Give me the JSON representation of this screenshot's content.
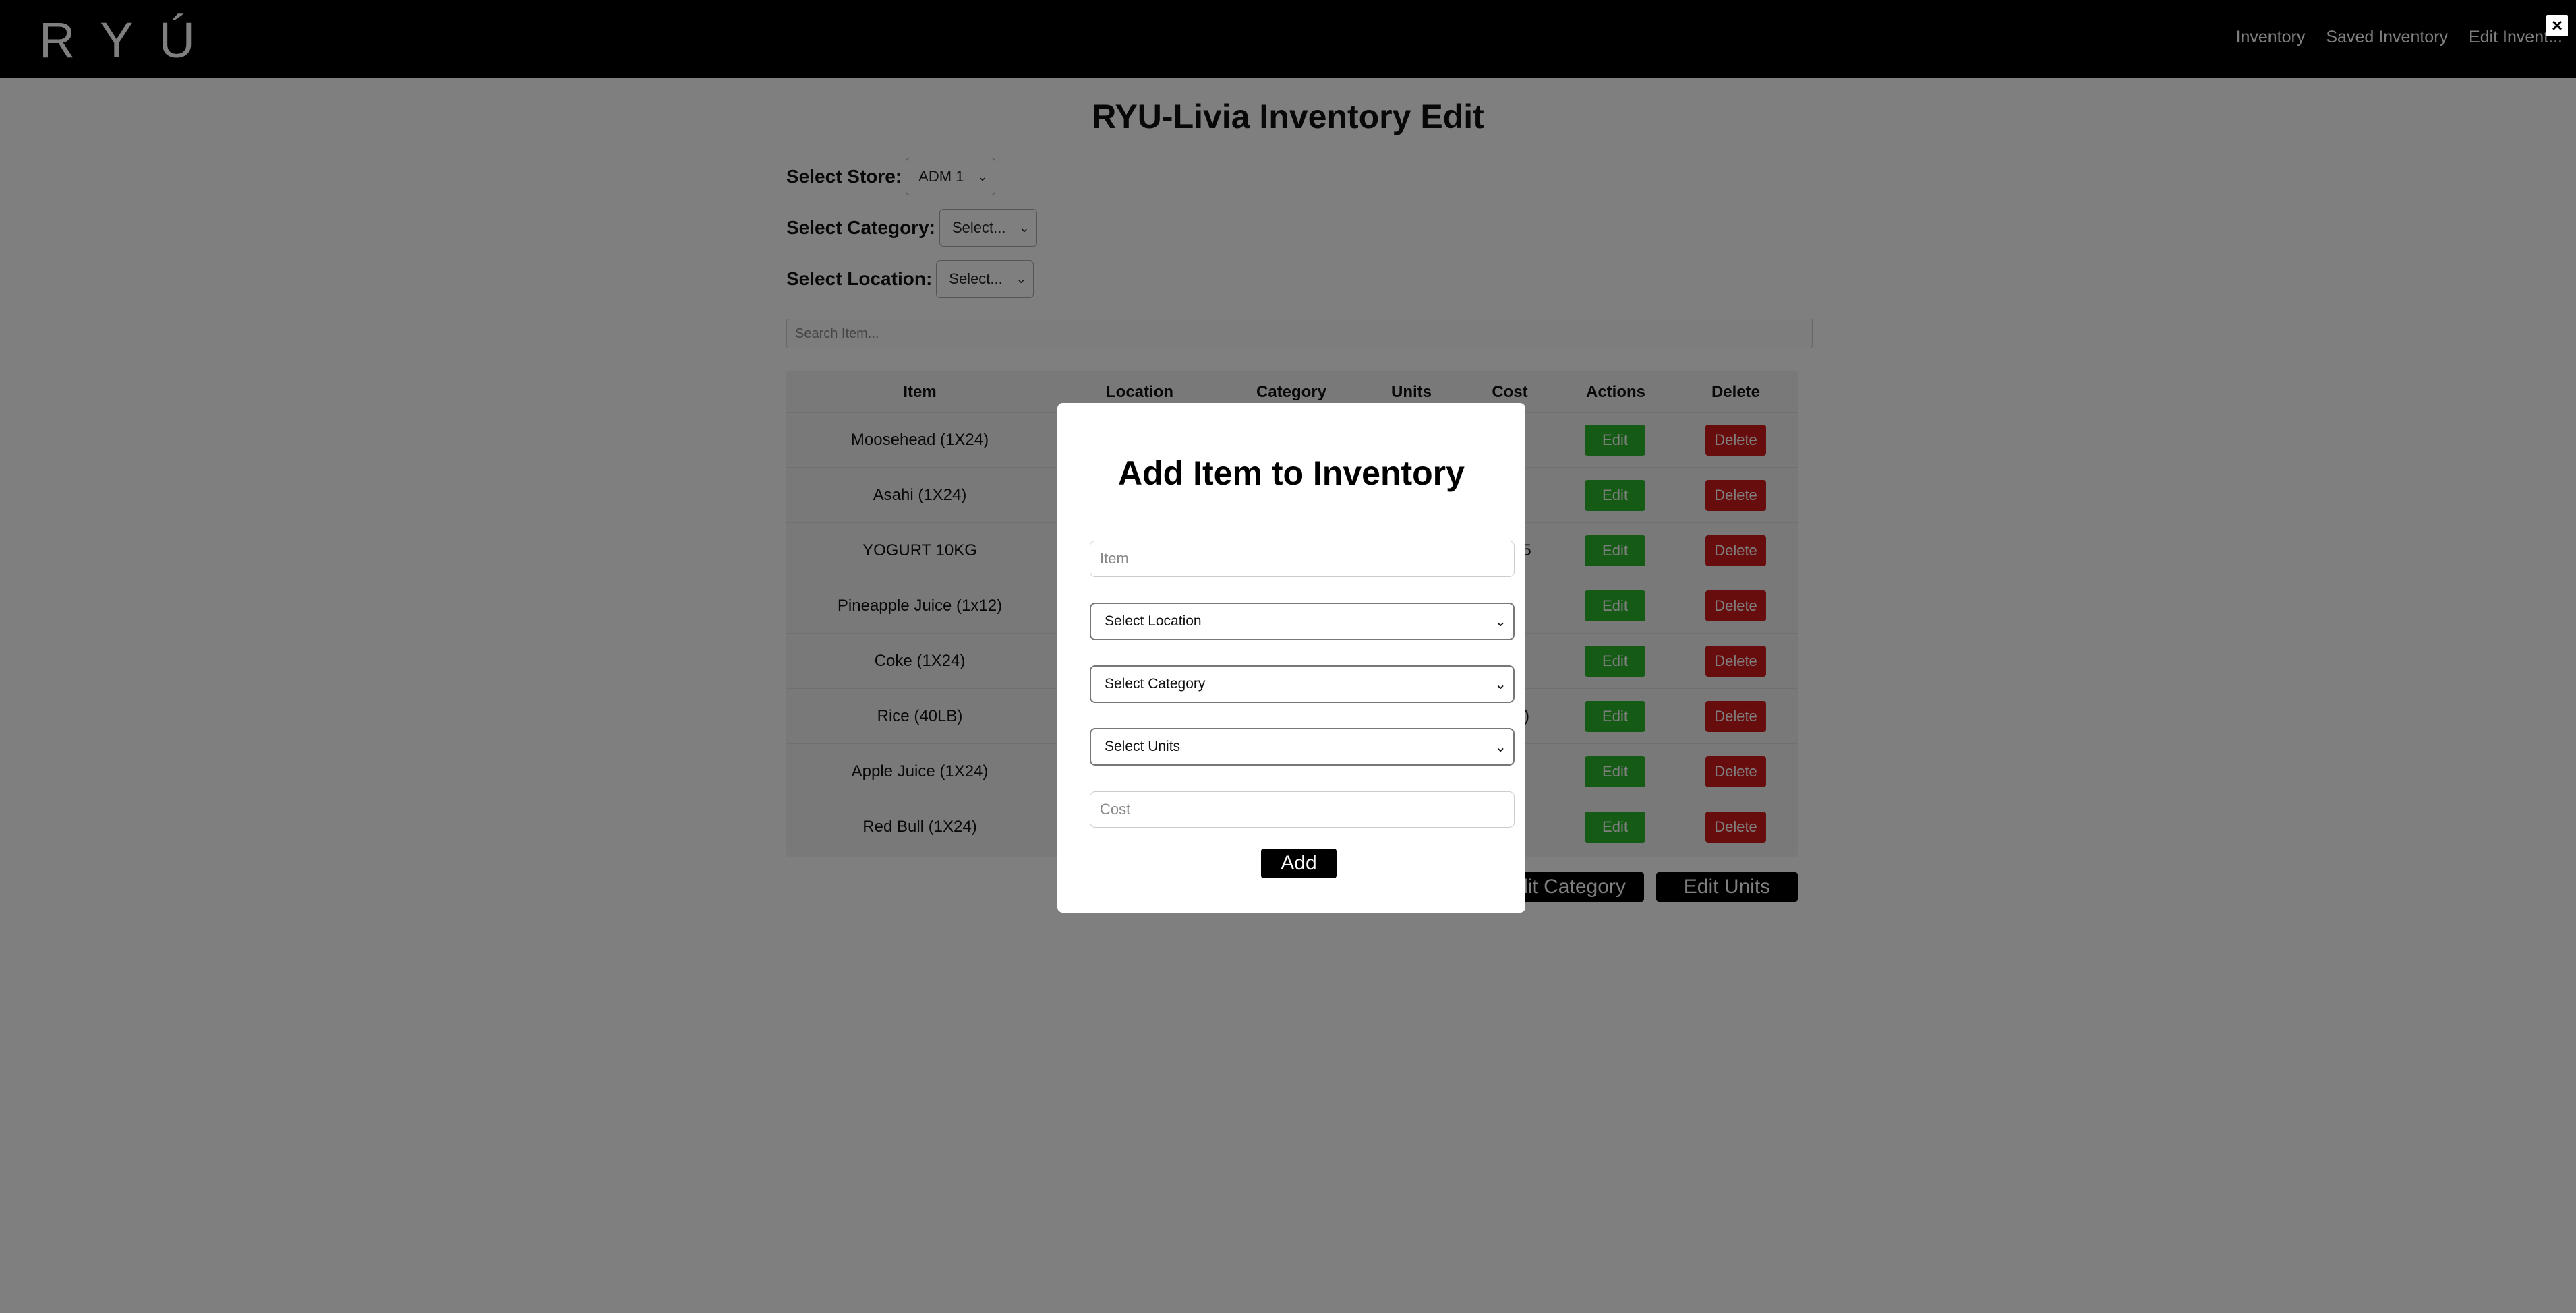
{
  "nav": {
    "logo": "RYÚ",
    "links": [
      "Inventory",
      "Saved Inventory",
      "Edit Invent..."
    ],
    "close_icon": "×"
  },
  "page": {
    "title": "RYU-Livia Inventory Edit",
    "filters": {
      "store_label": "Select Store:",
      "store_value": "ADM 1",
      "category_label": "Select Category:",
      "category_value": "Select...",
      "location_label": "Select Location:",
      "location_value": "Select..."
    },
    "search_placeholder": "Search Item..."
  },
  "table": {
    "headers": [
      "Item",
      "Location",
      "Category",
      "Units",
      "Cost",
      "Actions",
      "Delete"
    ],
    "rows": [
      {
        "item": "Moosehead (1X24)",
        "edit": "Edit",
        "delete": "Delete"
      },
      {
        "item": "Asahi (1X24)",
        "edit": "Edit",
        "delete": "Delete"
      },
      {
        "item": "YOGURT 10KG",
        "cost_fragment": "5",
        "edit": "Edit",
        "delete": "Delete"
      },
      {
        "item": "Pineapple Juice (1x12)",
        "edit": "Edit",
        "delete": "Delete"
      },
      {
        "item": "Coke (1X24)",
        "edit": "Edit",
        "delete": "Delete"
      },
      {
        "item": "Rice (40LB)",
        "cost_fragment": ")",
        "edit": "Edit",
        "delete": "Delete"
      },
      {
        "item": "Apple Juice (1X24)",
        "edit": "Edit",
        "delete": "Delete"
      },
      {
        "item": "Red Bull (1X24)",
        "edit": "Edit",
        "delete": "Delete"
      }
    ]
  },
  "bottom_buttons": {
    "edit_category": "Edit Category",
    "edit_units": "Edit Units"
  },
  "modal": {
    "title": "Add Item to Inventory",
    "item_placeholder": "Item",
    "location_select": "Select Location",
    "category_select": "Select Category",
    "units_select": "Select Units",
    "cost_placeholder": "Cost",
    "add_label": "Add"
  },
  "colors": {
    "edit_button": "#2bb52b",
    "delete_button": "#d11a1a",
    "nav_background": "#000000"
  }
}
